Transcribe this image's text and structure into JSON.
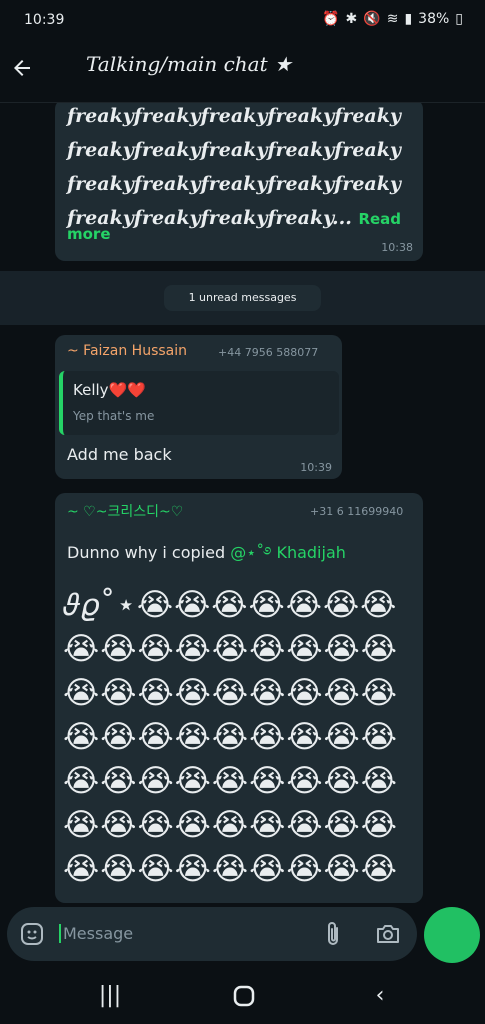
{
  "status": {
    "time": "10:39",
    "battery": "38%"
  },
  "header": {
    "title": "Talking/main chat ★"
  },
  "messages": {
    "m1": {
      "lines": [
        "freakyfreakyfreakyfreakyfreaky",
        "freakyfreakyfreakyfreakyfreaky",
        "freakyfreakyfreakyfreakyfreaky",
        "freakyfreakyfreakyfreaky..."
      ],
      "read_more_a": "Read",
      "read_more_b": "more",
      "time": "10:38"
    },
    "unread": "1 unread messages",
    "m2": {
      "sender": "~ Faizan Hussain",
      "phone": "+44 7956 588077",
      "quote_name": "Kelly❤️❤️",
      "quote_text": "Yep that's me",
      "text": "Add me back",
      "time": "10:39"
    },
    "m3": {
      "sender": "~ ♡~크리스디~♡",
      "phone": "+31 6 11699940",
      "text": "Dunno why i copied ",
      "mention": "@⋆˚࿔ Khadijah",
      "emoji_rows": [
        "𝜗𝜚˚⋆😭😭😭😭😭😭😭",
        "😭😭😭😭😭😭😭😭😭",
        "😭😭😭😭😭😭😭😭😭",
        "😭😭😭😭😭😭😭😭😭",
        "😭😭😭😭😭😭😭😭😭",
        "😭😭😭😭😭😭😭😭😭",
        "😭😭😭😭😭😭😭😭😭"
      ]
    }
  },
  "input": {
    "placeholder": "Message"
  },
  "colors": {
    "accent": "#25d366",
    "sender1": "#f4a46a",
    "bubble": "#1f2c33",
    "bg": "#0b1014"
  },
  "icons": [
    "back-arrow-icon",
    "sticker-icon",
    "attach-icon",
    "camera-icon",
    "mic-icon"
  ]
}
